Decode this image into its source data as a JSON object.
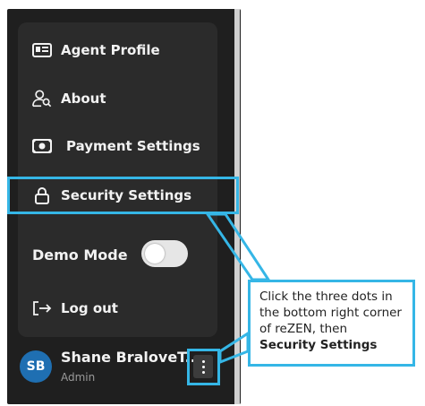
{
  "menu": {
    "items": [
      {
        "label": "Agent Profile",
        "icon": "id-card-icon"
      },
      {
        "label": "About",
        "icon": "user-search-icon"
      },
      {
        "label": "Payment Settings",
        "icon": "banknote-icon"
      },
      {
        "label": "Security Settings",
        "icon": "lock-icon"
      }
    ],
    "demo_mode_label": "Demo Mode",
    "demo_mode_on": false,
    "logout_label": "Log out"
  },
  "user": {
    "initials": "SB",
    "name": "Shane BraloveT..",
    "role": "Admin"
  },
  "callout": {
    "text": "Click the three dots in the bottom right corner of reZEN, then",
    "bold_text": "Security Settings"
  },
  "colors": {
    "highlight": "#35b6e6",
    "avatar": "#1f6fb2"
  }
}
